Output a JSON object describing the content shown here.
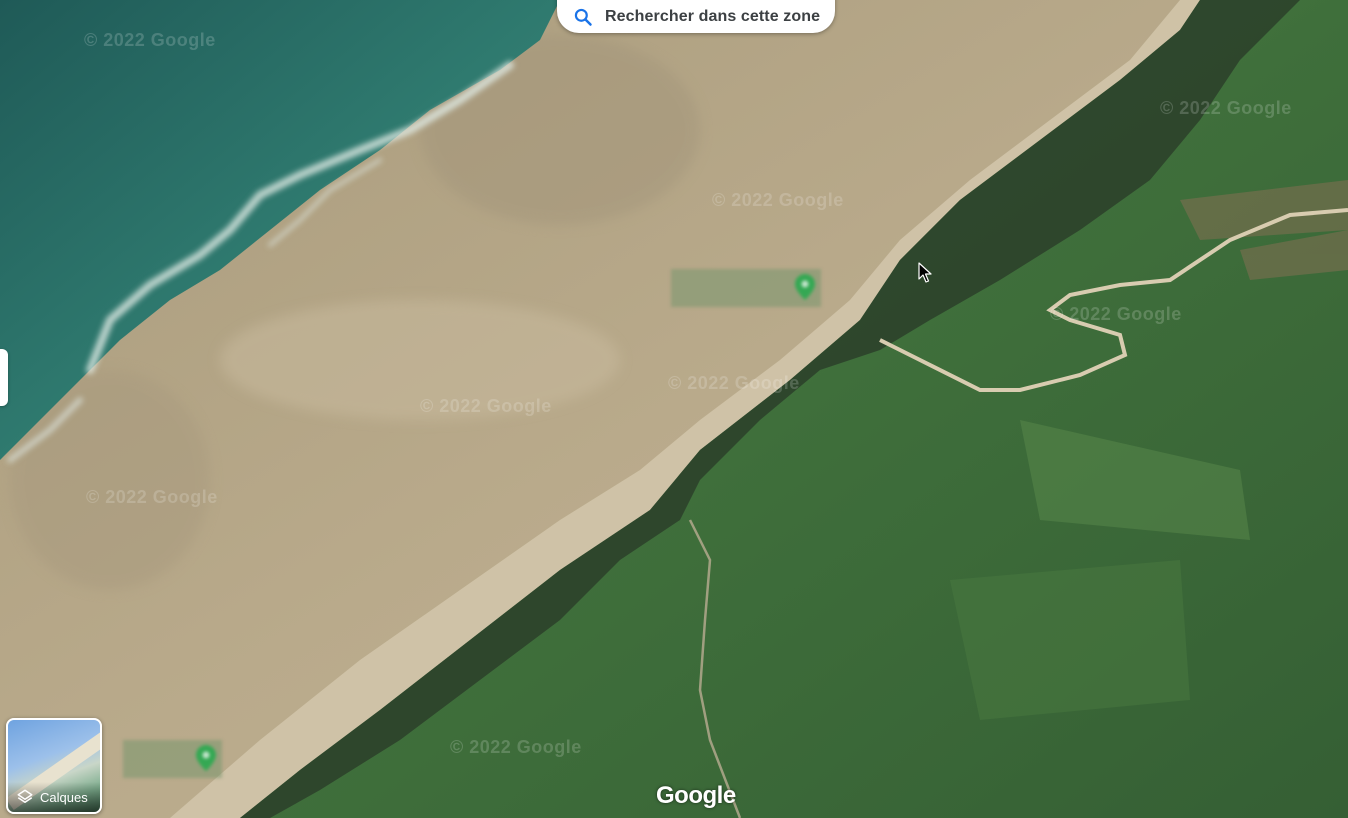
{
  "search": {
    "label": "Rechercher dans cette zone"
  },
  "layers": {
    "label": "Calques"
  },
  "logo": {
    "text": "Google"
  },
  "watermarks": [
    "© 2022 Google",
    "© 2022 Google",
    "© 2022 Google",
    "© 2022 Google",
    "© 2022 Google",
    "© 2022 Google",
    "© 2022 Google",
    "© 2022 Google"
  ],
  "colors": {
    "sea": "#2f6f68",
    "sand": "#b7a98c",
    "grass": "#3f6f3b",
    "pin": "#34a853"
  }
}
